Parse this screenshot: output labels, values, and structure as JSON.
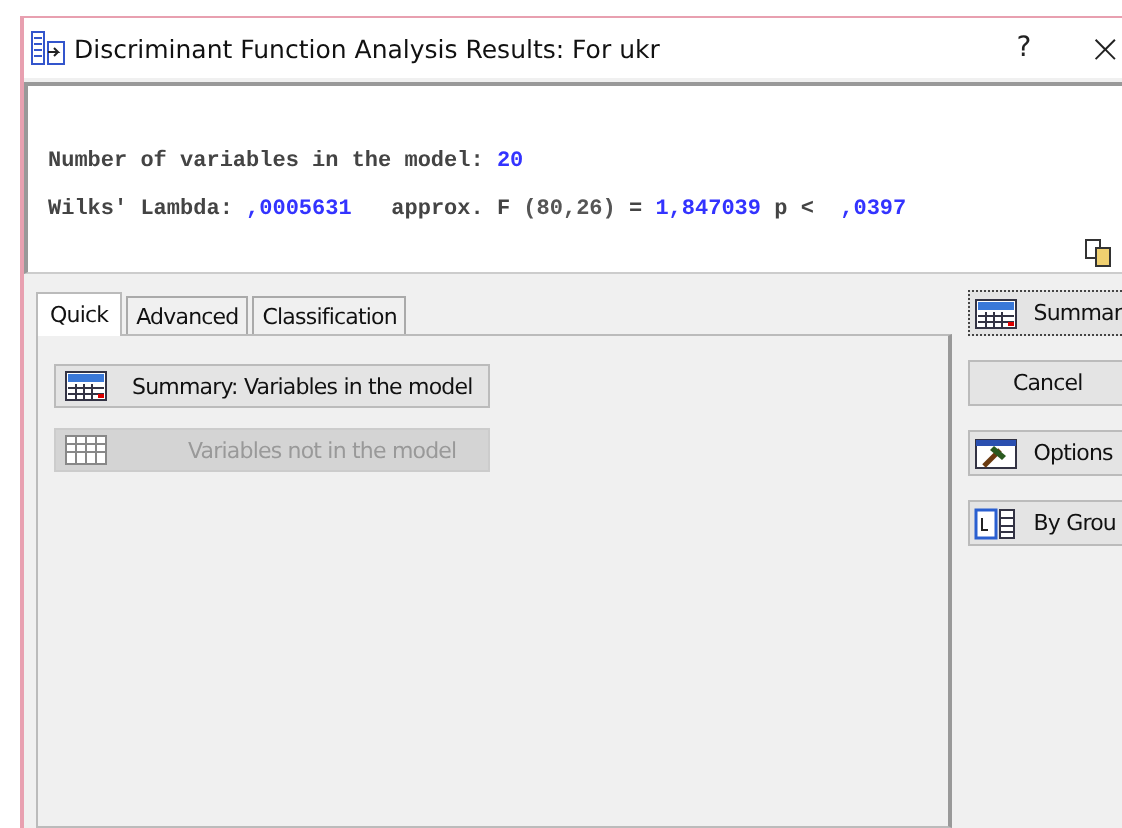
{
  "window": {
    "title": "Discriminant Function Analysis Results: For ukr",
    "help": "?",
    "close": "×"
  },
  "results": {
    "lines": [
      [
        {
          "text": "Number of variables in the model: ",
          "kind": "label"
        },
        {
          "text": "20",
          "kind": "value"
        }
      ],
      [
        {
          "text": "Wilks' Lambda: ",
          "kind": "label"
        },
        {
          "text": ",0005631",
          "kind": "value"
        },
        {
          "text": "   approx. F ",
          "kind": "label"
        },
        {
          "text": "(80,26)",
          "kind": "param"
        },
        {
          "text": " = ",
          "kind": "label"
        },
        {
          "text": "1,847039",
          "kind": "value"
        },
        {
          "text": " p < ",
          "kind": "label"
        },
        {
          "text": " ,0397",
          "kind": "value"
        }
      ]
    ]
  },
  "tabs": [
    {
      "label": "Quick",
      "selected": true
    },
    {
      "label": "Advanced",
      "selected": false
    },
    {
      "label": "Classification",
      "selected": false
    }
  ],
  "panel_buttons": [
    {
      "label": "Summary:  Variables in the model",
      "disabled": false
    },
    {
      "label": "Variables not in the model",
      "disabled": true
    }
  ],
  "side_buttons": [
    {
      "label": "Summar",
      "kind": "summary",
      "default": true
    },
    {
      "label": "Cancel",
      "kind": "plain",
      "default": false
    },
    {
      "label": "Options",
      "kind": "options",
      "default": false
    },
    {
      "label": "By Grou",
      "kind": "groups",
      "default": false
    }
  ]
}
